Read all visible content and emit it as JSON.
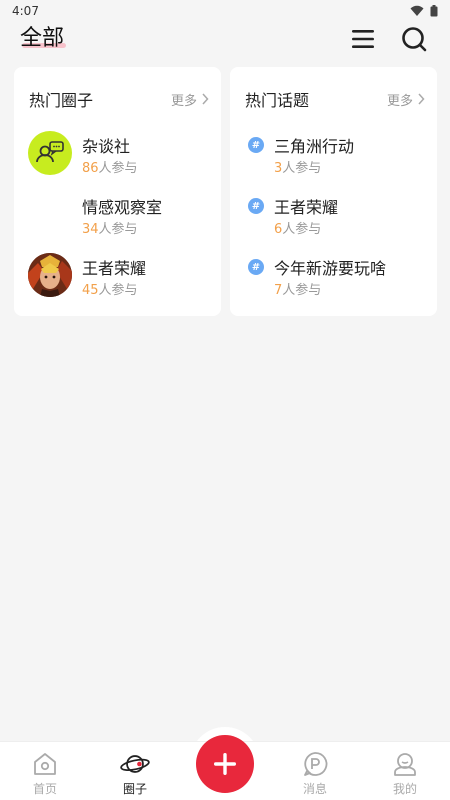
{
  "status_bar": {
    "time": "4:07",
    "icons": [
      "wifi-icon",
      "battery-icon"
    ]
  },
  "header": {
    "title": "全部",
    "icons": [
      "menu-icon",
      "search-icon"
    ]
  },
  "hot_circles": {
    "title": "热门圈子",
    "more_label": "更多",
    "suffix": "人参与",
    "items": [
      {
        "name": "杂谈社",
        "count": "86",
        "icon": "chat-people-icon"
      },
      {
        "name": "情感观察室",
        "count": "34",
        "icon": ""
      },
      {
        "name": "王者荣耀",
        "count": "45",
        "icon": "game-avatar-icon"
      }
    ]
  },
  "hot_topics": {
    "title": "热门话题",
    "more_label": "更多",
    "suffix": "人参与",
    "items": [
      {
        "name": "三角洲行动",
        "count": "3",
        "icon": "hashtag-icon"
      },
      {
        "name": "王者荣耀",
        "count": "6",
        "icon": "hashtag-icon"
      },
      {
        "name": "今年新游要玩啥",
        "count": "7",
        "icon": "hashtag-icon"
      }
    ]
  },
  "tabbar": {
    "items": [
      {
        "label": "首页",
        "icon": "home-icon"
      },
      {
        "label": "圈子",
        "icon": "planet-icon",
        "active": true
      },
      {
        "label": "",
        "icon": "plus-icon"
      },
      {
        "label": "消息",
        "icon": "message-icon"
      },
      {
        "label": "我的",
        "icon": "profile-icon"
      }
    ]
  },
  "colors": {
    "accent_red": "#e8283c",
    "count_orange": "#f2a04a",
    "topic_blue": "#6aa9f4",
    "circle_green": "#c7ec1f"
  }
}
